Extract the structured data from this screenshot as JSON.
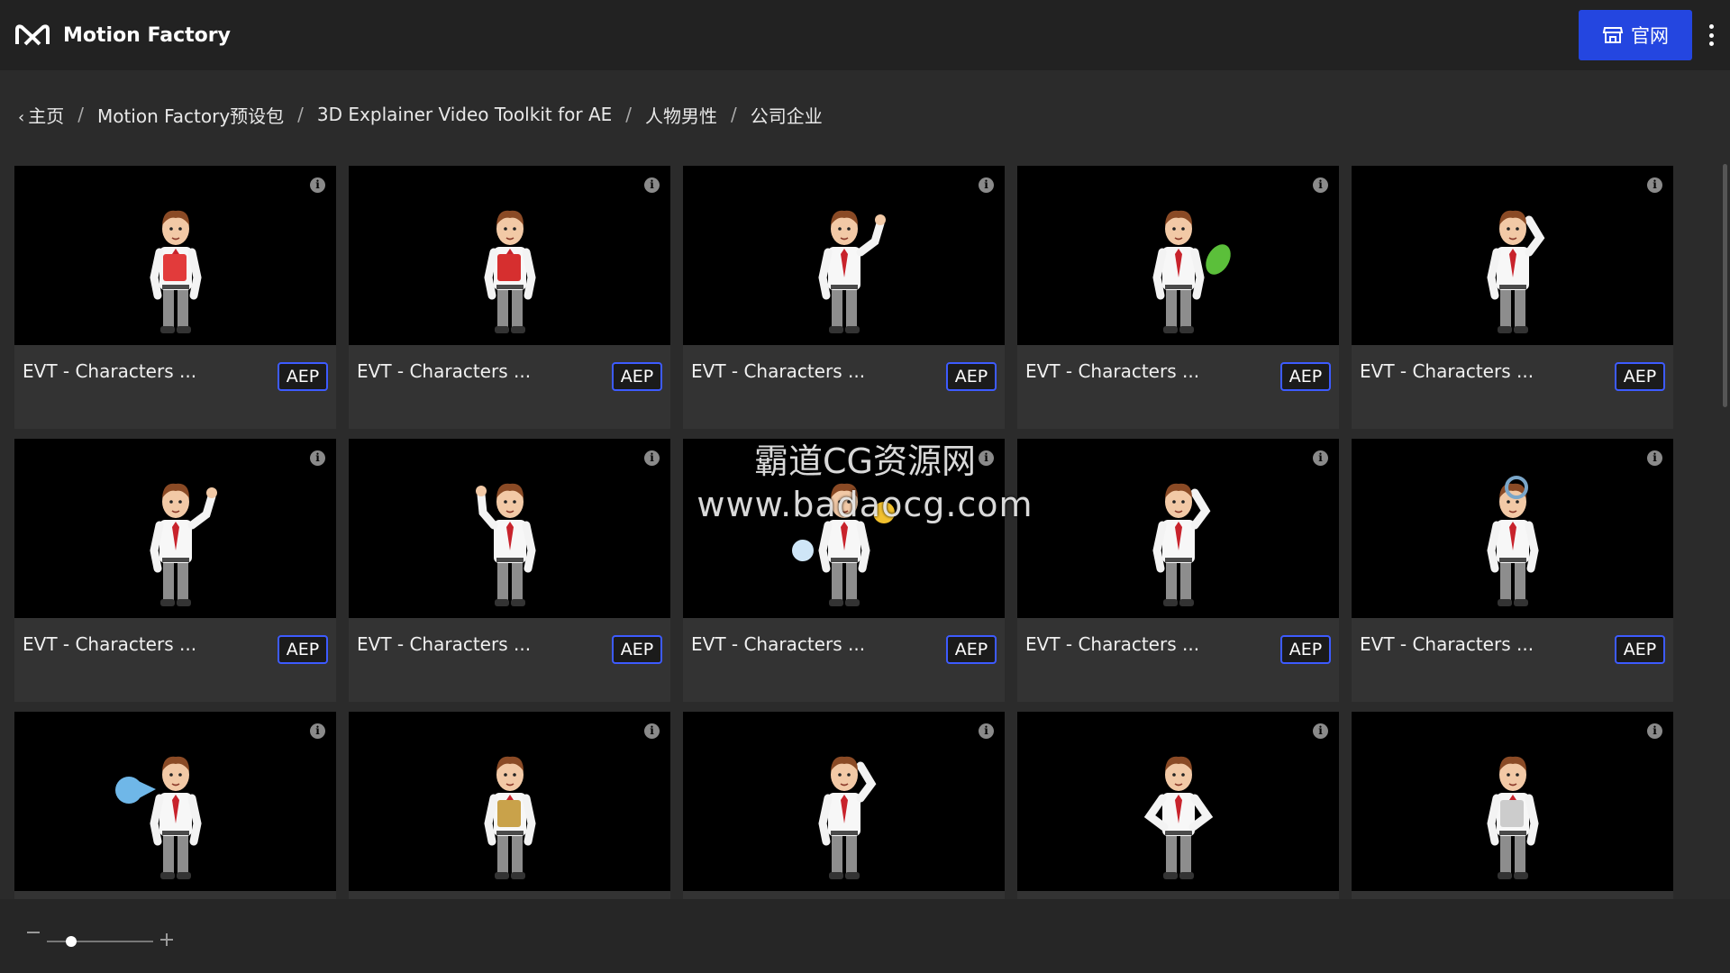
{
  "app": {
    "title": "Motion Factory"
  },
  "header": {
    "site_button_label": "官网"
  },
  "breadcrumb": [
    {
      "label": "主页",
      "is_back": true
    },
    {
      "label": "Motion Factory预设包"
    },
    {
      "label": "3D Explainer Video Toolkit for AE"
    },
    {
      "label": "人物男性"
    },
    {
      "label": "公司企业"
    }
  ],
  "items": [
    {
      "title": "EVT - Characters ...",
      "format": "AEP",
      "pose": "clipboard",
      "prop_color": "#e23b3b"
    },
    {
      "title": "EVT - Characters ...",
      "format": "AEP",
      "pose": "gift",
      "prop_color": "#d62f2f"
    },
    {
      "title": "EVT - Characters ...",
      "format": "AEP",
      "pose": "wave",
      "prop_color": ""
    },
    {
      "title": "EVT - Characters ...",
      "format": "AEP",
      "pose": "leaf",
      "prop_color": "#5bbf3a"
    },
    {
      "title": "EVT - Characters ...",
      "format": "AEP",
      "pose": "think",
      "prop_color": ""
    },
    {
      "title": "EVT - Characters ...",
      "format": "AEP",
      "pose": "wave-right",
      "prop_color": ""
    },
    {
      "title": "EVT - Characters ...",
      "format": "AEP",
      "pose": "point-up",
      "prop_color": ""
    },
    {
      "title": "EVT - Characters ...",
      "format": "AEP",
      "pose": "juggle",
      "prop_color": "#f2c12e"
    },
    {
      "title": "EVT - Characters ...",
      "format": "AEP",
      "pose": "phone",
      "prop_color": ""
    },
    {
      "title": "EVT - Characters ...",
      "format": "AEP",
      "pose": "magnifier",
      "prop_color": "#7aa6c9"
    },
    {
      "title": "",
      "format": "",
      "pose": "megaphone",
      "prop_color": "#6fb7e8"
    },
    {
      "title": "",
      "format": "",
      "pose": "money-bag",
      "prop_color": "#c9a24a"
    },
    {
      "title": "",
      "format": "",
      "pose": "scratch-head",
      "prop_color": ""
    },
    {
      "title": "",
      "format": "",
      "pose": "hands-hips",
      "prop_color": ""
    },
    {
      "title": "",
      "format": "",
      "pose": "writing",
      "prop_color": ""
    }
  ],
  "zoom": {
    "level": 0.18
  },
  "watermark": {
    "line1": "霸道CG资源网",
    "line2": "www.badaocg.com"
  },
  "icons": {
    "logo": "motion-factory-logo",
    "store": "store-icon",
    "info": "info-icon",
    "more": "more-vertical-icon"
  },
  "colors": {
    "accent": "#2446e0",
    "badge_border": "#3d5bff"
  }
}
